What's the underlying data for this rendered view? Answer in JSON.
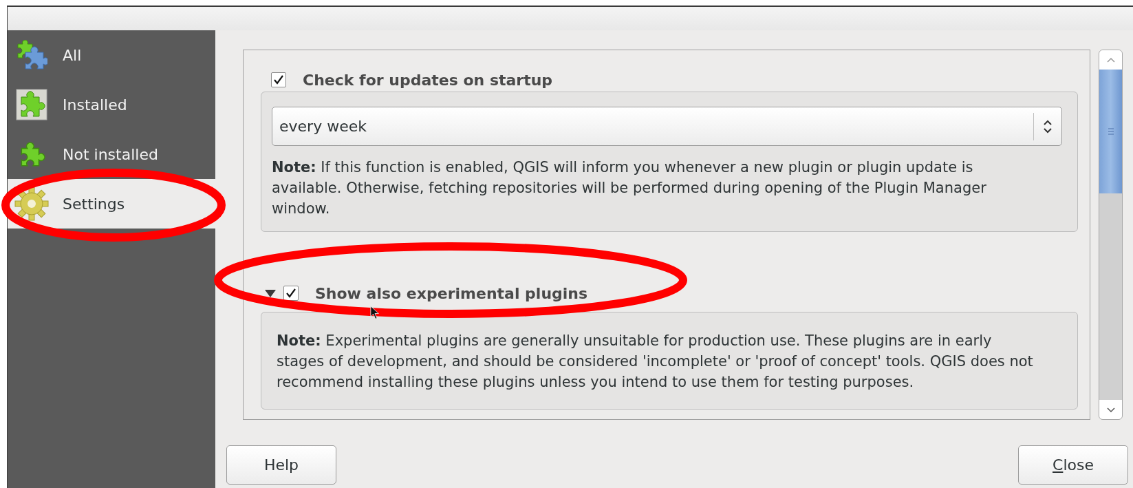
{
  "sidebar": {
    "items": [
      {
        "label": "All",
        "selected": false
      },
      {
        "label": "Installed",
        "selected": false
      },
      {
        "label": "Not installed",
        "selected": false
      },
      {
        "label": "Settings",
        "selected": true
      }
    ]
  },
  "update_check": {
    "label": "Check for updates on startup",
    "checked": true,
    "interval": "every week",
    "note": "**Note:** If this function is enabled, QGIS will inform you whenever a new plugin or plugin update is available. Otherwise, fetching repositories will be performed during opening of the Plugin Manager window."
  },
  "experimental": {
    "label": "Show also experimental plugins",
    "checked": true,
    "expanded": true,
    "note": "**Note:** Experimental plugins are generally unsuitable for production use. These plugins are in early stages of development, and should be considered 'incomplete' or 'proof of concept' tools. QGIS does not recommend installing these plugins unless you intend to use them for testing purposes."
  },
  "buttons": [
    {
      "label": "Help",
      "mnemonic_underlined": false
    },
    {
      "label": "Close",
      "mnemonic_underlined": true
    }
  ]
}
